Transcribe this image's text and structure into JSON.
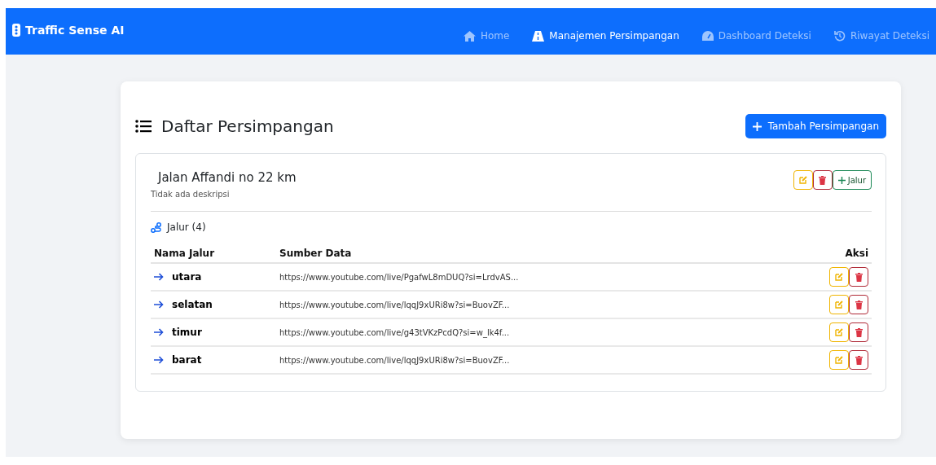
{
  "navbar": {
    "brand": "Traffic Sense AI",
    "items": [
      {
        "label": "Home",
        "selected": false
      },
      {
        "label": "Manajemen Persimpangan",
        "selected": true
      },
      {
        "label": "Dashboard Deteksi",
        "selected": false
      },
      {
        "label": "Riwayat Deteksi",
        "selected": false
      }
    ]
  },
  "page": {
    "title": "Daftar Persimpangan",
    "add_button": "Tambah Persimpangan"
  },
  "intersections": [
    {
      "name": "Jalan Affandi no 22 km",
      "description": "Tidak ada deskripsi",
      "add_lane_button": "Jalur",
      "lanes_heading": "Jalur (4)",
      "columns": [
        "Nama Jalur",
        "Sumber Data",
        "Aksi"
      ],
      "lanes": [
        {
          "name": "utara",
          "source": "https://www.youtube.com/live/PgafwL8mDUQ?si=LrdvAS..."
        },
        {
          "name": "selatan",
          "source": "https://www.youtube.com/live/lqqJ9xURi8w?si=BuovZF..."
        },
        {
          "name": "timur",
          "source": "https://www.youtube.com/live/g43tVKzPcdQ?si=w_lk4f..."
        },
        {
          "name": "barat",
          "source": "https://www.youtube.com/live/lqqJ9xURi8w?si=BuovZF..."
        }
      ]
    }
  ]
}
